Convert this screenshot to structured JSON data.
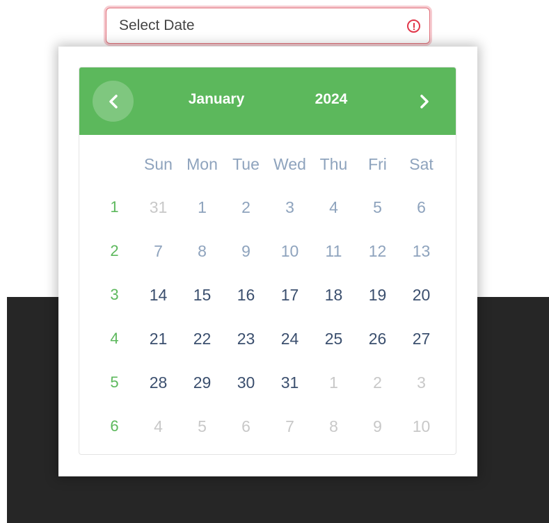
{
  "input": {
    "placeholder": "Select Date",
    "value": "",
    "error_icon": "exclamation-circle-icon",
    "error_color": "#e1374a"
  },
  "calendar": {
    "month": "January",
    "year": "2024",
    "header_color": "#5cb85c",
    "prev_icon": "chevron-left-icon",
    "next_icon": "chevron-right-icon",
    "day_headers": [
      "Sun",
      "Mon",
      "Tue",
      "Wed",
      "Thu",
      "Fri",
      "Sat"
    ],
    "weeks": [
      {
        "week": "1",
        "days": [
          {
            "label": "31",
            "state": "other"
          },
          {
            "label": "1",
            "state": "past"
          },
          {
            "label": "2",
            "state": "past"
          },
          {
            "label": "3",
            "state": "past"
          },
          {
            "label": "4",
            "state": "past"
          },
          {
            "label": "5",
            "state": "past"
          },
          {
            "label": "6",
            "state": "past"
          }
        ]
      },
      {
        "week": "2",
        "days": [
          {
            "label": "7",
            "state": "past"
          },
          {
            "label": "8",
            "state": "past"
          },
          {
            "label": "9",
            "state": "past"
          },
          {
            "label": "10",
            "state": "past"
          },
          {
            "label": "11",
            "state": "past"
          },
          {
            "label": "12",
            "state": "past"
          },
          {
            "label": "13",
            "state": "past"
          }
        ]
      },
      {
        "week": "3",
        "days": [
          {
            "label": "14",
            "state": "current"
          },
          {
            "label": "15",
            "state": "current"
          },
          {
            "label": "16",
            "state": "current"
          },
          {
            "label": "17",
            "state": "current"
          },
          {
            "label": "18",
            "state": "current"
          },
          {
            "label": "19",
            "state": "current"
          },
          {
            "label": "20",
            "state": "current"
          }
        ]
      },
      {
        "week": "4",
        "days": [
          {
            "label": "21",
            "state": "current"
          },
          {
            "label": "22",
            "state": "current"
          },
          {
            "label": "23",
            "state": "current"
          },
          {
            "label": "24",
            "state": "current"
          },
          {
            "label": "25",
            "state": "current"
          },
          {
            "label": "26",
            "state": "current"
          },
          {
            "label": "27",
            "state": "current"
          }
        ]
      },
      {
        "week": "5",
        "days": [
          {
            "label": "28",
            "state": "current"
          },
          {
            "label": "29",
            "state": "current"
          },
          {
            "label": "30",
            "state": "current"
          },
          {
            "label": "31",
            "state": "current"
          },
          {
            "label": "1",
            "state": "other"
          },
          {
            "label": "2",
            "state": "other"
          },
          {
            "label": "3",
            "state": "other"
          }
        ]
      },
      {
        "week": "6",
        "days": [
          {
            "label": "4",
            "state": "other"
          },
          {
            "label": "5",
            "state": "other"
          },
          {
            "label": "6",
            "state": "other"
          },
          {
            "label": "7",
            "state": "other"
          },
          {
            "label": "8",
            "state": "other"
          },
          {
            "label": "9",
            "state": "other"
          },
          {
            "label": "10",
            "state": "other"
          }
        ]
      }
    ]
  }
}
